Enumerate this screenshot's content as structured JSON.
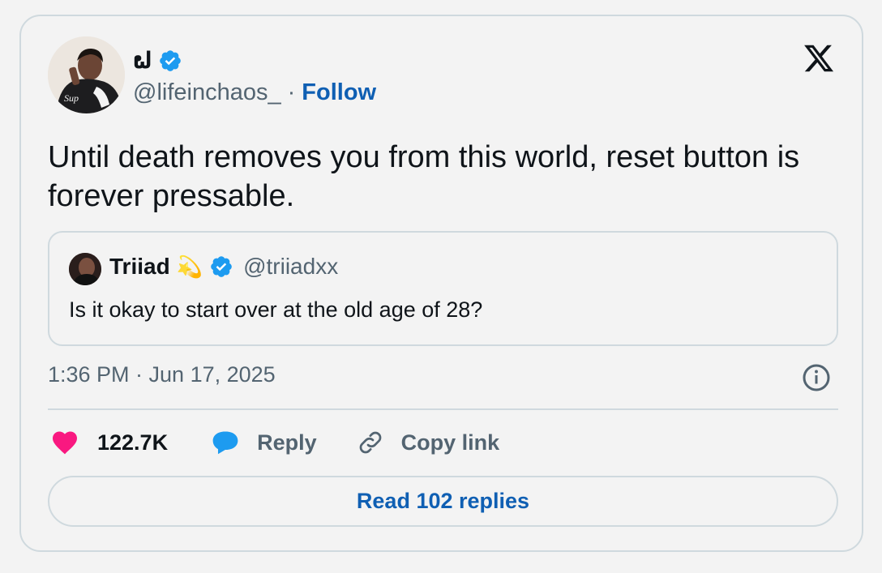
{
  "author": {
    "display_name": "ຝ",
    "handle": "@lifeinchaos_",
    "separator": "·",
    "follow_label": "Follow",
    "verified": true
  },
  "tweet": {
    "text": "Until death removes you from this world, reset button is forever pressable."
  },
  "quoted": {
    "display_name": "Triiad",
    "emoji": "💫",
    "handle": "@triiadxx",
    "text": "Is it okay to start over at the old age of 28?",
    "verified": true
  },
  "timestamp": "1:36 PM · Jun 17, 2025",
  "actions": {
    "likes_count": "122.7K",
    "reply_label": "Reply",
    "copy_link_label": "Copy link"
  },
  "read_replies_label": "Read 102 replies",
  "colors": {
    "background": "#f3f3f3",
    "border": "#cfd9de",
    "link_blue": "#0f5fb3",
    "verified_blue": "#1d9bf0",
    "like_pink": "#f91880",
    "muted_text": "#536471",
    "text": "#0f1419"
  },
  "icons": [
    "verified-badge-icon",
    "x-logo-icon",
    "info-icon",
    "heart-icon",
    "reply-bubble-icon",
    "link-icon"
  ]
}
